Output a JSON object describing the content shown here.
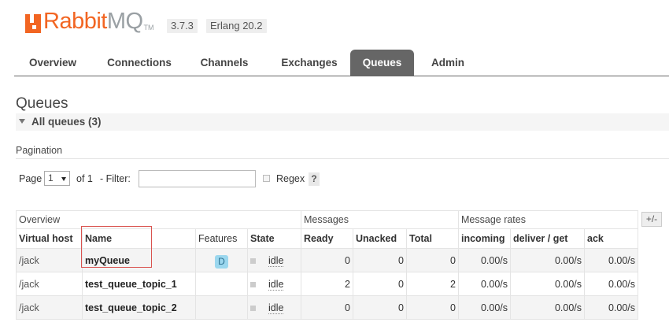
{
  "header": {
    "logo_rabbit": "Rabbit",
    "logo_mq": "MQ",
    "logo_tm": "TM",
    "version": "3.7.3",
    "erlang": "Erlang 20.2"
  },
  "tabs": [
    {
      "label": "Overview",
      "active": false
    },
    {
      "label": "Connections",
      "active": false
    },
    {
      "label": "Channels",
      "active": false
    },
    {
      "label": "Exchanges",
      "active": false
    },
    {
      "label": "Queues",
      "active": true
    },
    {
      "label": "Admin",
      "active": false
    }
  ],
  "page": {
    "title": "Queues",
    "section": "All queues (3)"
  },
  "pagination": {
    "label": "Pagination",
    "page_label": "Page",
    "page_value": "1",
    "of_label": "of 1",
    "filter_label": "- Filter:",
    "filter_value": "",
    "regex_label": "Regex",
    "help": "?"
  },
  "table": {
    "groups": {
      "overview": "Overview",
      "messages": "Messages",
      "rates": "Message rates"
    },
    "toggle": "+/-",
    "headers": {
      "vhost": "Virtual host",
      "name": "Name",
      "features": "Features",
      "state": "State",
      "ready": "Ready",
      "unacked": "Unacked",
      "total": "Total",
      "incoming": "incoming",
      "deliver": "deliver / get",
      "ack": "ack"
    },
    "rows": [
      {
        "vhost": "/jack",
        "name": "myQueue",
        "features": "D",
        "state": "idle",
        "ready": "0",
        "unacked": "0",
        "total": "0",
        "incoming": "0.00/s",
        "deliver": "0.00/s",
        "ack": "0.00/s"
      },
      {
        "vhost": "/jack",
        "name": "test_queue_topic_1",
        "features": "",
        "state": "idle",
        "ready": "2",
        "unacked": "0",
        "total": "2",
        "incoming": "0.00/s",
        "deliver": "0.00/s",
        "ack": "0.00/s"
      },
      {
        "vhost": "/jack",
        "name": "test_queue_topic_2",
        "features": "",
        "state": "idle",
        "ready": "0",
        "unacked": "0",
        "total": "0",
        "incoming": "0.00/s",
        "deliver": "0.00/s",
        "ack": "0.00/s"
      }
    ]
  },
  "colors": {
    "brand_orange": "#f26522",
    "brand_grey": "#9aa0a4",
    "active_tab": "#666666",
    "durable_badge": "#9bd7ee",
    "highlight_box": "#d9534f"
  }
}
